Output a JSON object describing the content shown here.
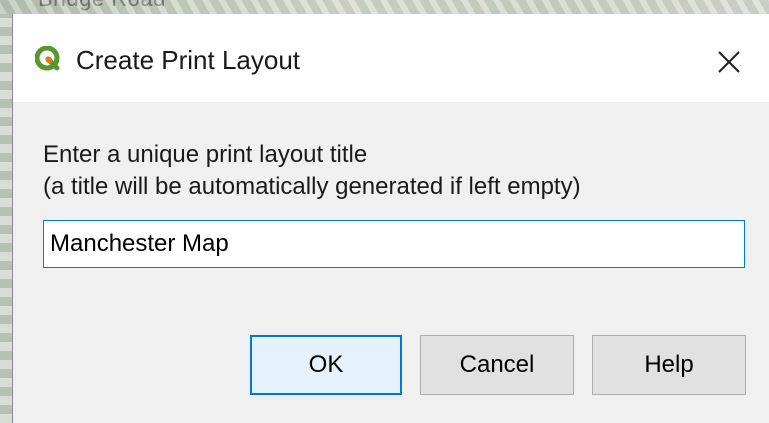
{
  "background": {
    "partial_text": "Bridge Road"
  },
  "dialog": {
    "title": "Create Print Layout",
    "app_icon": "qgis-icon",
    "close_icon": "close-icon",
    "prompt_line1": "Enter a unique print layout title",
    "prompt_line2": "(a title will be automatically generated if left empty)",
    "title_input_value": "Manchester Map",
    "buttons": {
      "ok": "OK",
      "cancel": "Cancel",
      "help": "Help"
    }
  },
  "colors": {
    "focus_accent": "#0078d7",
    "qgis_green": "#589632",
    "qgis_yellow": "#ee7913"
  }
}
